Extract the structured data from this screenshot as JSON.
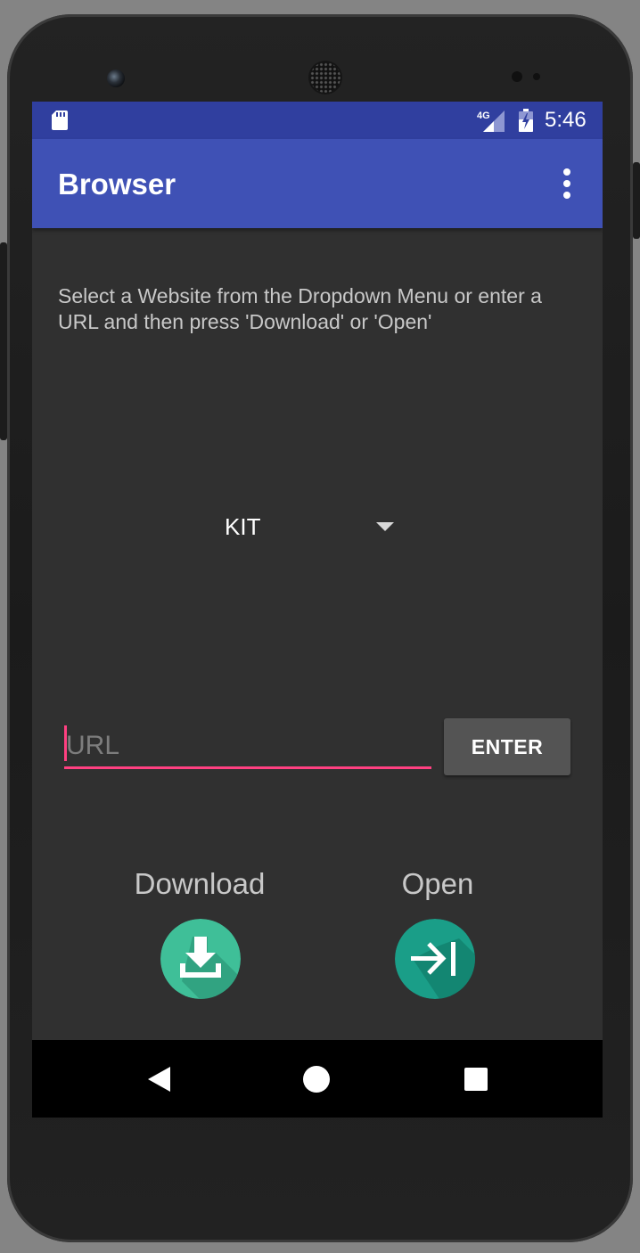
{
  "status_bar": {
    "time": "5:46",
    "network": "4G",
    "icons": [
      "sd-card-icon",
      "signal-icon",
      "battery-icon"
    ]
  },
  "app_bar": {
    "title": "Browser",
    "overflow_icon": "more-vert-icon"
  },
  "main": {
    "instructions": "Select a Website from the Dropdown Menu or enter a URL and then press 'Download' or 'Open'",
    "website_spinner": {
      "selected": "KIT"
    },
    "url_input": {
      "value": "",
      "placeholder": "URL"
    },
    "enter_label": "ENTER",
    "download_label": "Download",
    "open_label": "Open"
  },
  "nav_bar": {
    "icons": [
      "back-icon",
      "home-icon",
      "recents-icon"
    ]
  },
  "colors": {
    "status_bar": "#303f9f",
    "app_bar": "#3f51b5",
    "background": "#303030",
    "accent": "#ff4081",
    "download_fab": "#3fbf98",
    "open_fab": "#1a9e88"
  }
}
